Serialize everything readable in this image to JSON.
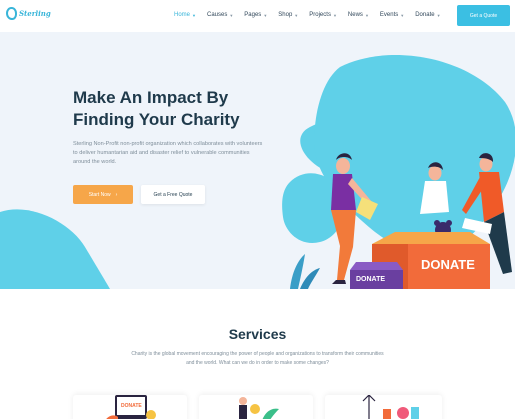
{
  "brand": {
    "logo_text": "Sterling"
  },
  "nav": {
    "items": [
      {
        "label": "Home",
        "active": true,
        "dropdown": true
      },
      {
        "label": "Causes",
        "active": false,
        "dropdown": true
      },
      {
        "label": "Pages",
        "active": false,
        "dropdown": true
      },
      {
        "label": "Shop",
        "active": false,
        "dropdown": true
      },
      {
        "label": "Projects",
        "active": false,
        "dropdown": true
      },
      {
        "label": "News",
        "active": false,
        "dropdown": true
      },
      {
        "label": "Events",
        "active": false,
        "dropdown": true
      },
      {
        "label": "Donate",
        "active": false,
        "dropdown": true
      }
    ],
    "cta_label": "Get a Quote"
  },
  "hero": {
    "title_line1": "Make An Impact By",
    "title_line2": "Finding Your Charity",
    "description": "Sterling Non-Profit non-profit organization which collaborates with volunteers to deliver humantarian aid and disaster relief to vulnerable communities around the world.",
    "primary_button": "Start Now",
    "secondary_button": "Get a Free Quote",
    "illustration_big_box_label": "DONATE",
    "illustration_small_box_label": "DONATE"
  },
  "services": {
    "title": "Services",
    "description": "Charity is the global movement encouraging the power of people and organizations to transform their communities and the world. What can we do in order to make some changes?",
    "card1_label": "DONATE"
  },
  "colors": {
    "accent": "#39b5d9",
    "orange": "#f6a649",
    "heading": "#1f3a4b",
    "hero_bg": "#eff4fa",
    "donate_red": "#f26b3a"
  },
  "icons": [
    "logo-drop-icon",
    "chevron-down-icon",
    "arrow-right-icon"
  ]
}
